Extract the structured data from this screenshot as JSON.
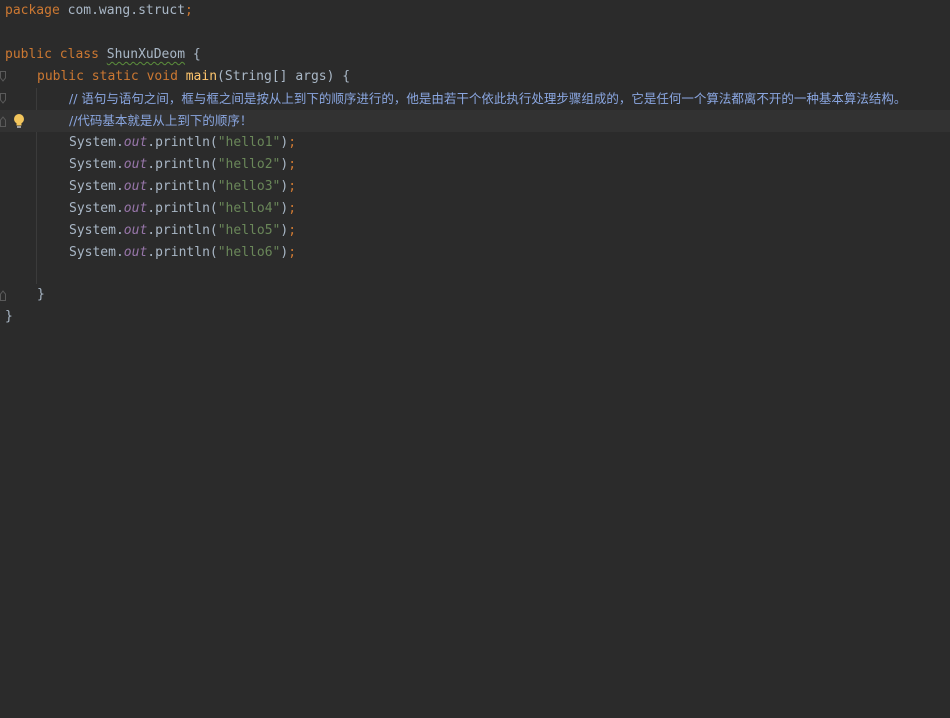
{
  "editor": {
    "package_line": {
      "keyword": "package",
      "name": "com.wang.struct",
      "semicolon": ";"
    },
    "class_decl": {
      "mod": "public",
      "kw": "class",
      "name": "ShunXuDeom",
      "brace": "{"
    },
    "method_decl": {
      "mod1": "public",
      "mod2": "static",
      "ret": "void",
      "name": "main",
      "params": "(String[] args) {"
    },
    "comment1": "// 语句与语句之间，框与框之间是按从上到下的顺序进行的，他是由若干个依此执行处理步骤组成的，它是任何一个算法都离不开的一种基本算法结构。",
    "comment2": "//代码基本就是从上到下的顺序！",
    "println_lines": [
      {
        "prefix": "System.",
        "field": "out",
        "call": ".println(",
        "arg": "\"hello1\"",
        "end": ")",
        "semi": ";"
      },
      {
        "prefix": "System.",
        "field": "out",
        "call": ".println(",
        "arg": "\"hello2\"",
        "end": ")",
        "semi": ";"
      },
      {
        "prefix": "System.",
        "field": "out",
        "call": ".println(",
        "arg": "\"hello3\"",
        "end": ")",
        "semi": ";"
      },
      {
        "prefix": "System.",
        "field": "out",
        "call": ".println(",
        "arg": "\"hello4\"",
        "end": ")",
        "semi": ";"
      },
      {
        "prefix": "System.",
        "field": "out",
        "call": ".println(",
        "arg": "\"hello5\"",
        "end": ")",
        "semi": ";"
      },
      {
        "prefix": "System.",
        "field": "out",
        "call": ".println(",
        "arg": "\"hello6\"",
        "end": ")",
        "semi": ";"
      }
    ],
    "method_close": "}",
    "class_close": "}",
    "icons": {
      "intention": "lightbulb-icon",
      "fold": "fold-marker-icon"
    },
    "colors": {
      "background": "#2b2b2b",
      "keyword": "#cc7832",
      "string": "#6a8759",
      "field": "#9876aa",
      "method": "#ffc66d",
      "comment": "#8aa6e0",
      "text": "#a9b7c6"
    }
  }
}
